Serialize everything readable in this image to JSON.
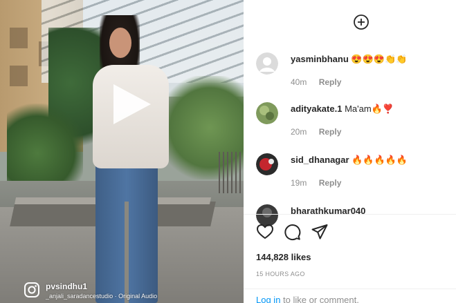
{
  "video": {
    "username": "pvsindhu1",
    "audio": "_anjali_saradancestudio · Original Audio",
    "logo_icon": "instagram-icon",
    "play_icon": "play-icon"
  },
  "panel": {
    "add_icon": "add-circle-icon",
    "comments": [
      {
        "username": "yasminbhanu",
        "text": "",
        "emojis": [
          "😍",
          "😍",
          "😍",
          "👏",
          "👏"
        ],
        "time": "40m",
        "reply_label": "Reply",
        "avatar": "default-avatar"
      },
      {
        "username": "adityakate.1",
        "text": "Ma'am",
        "emojis": [
          "🔥",
          "❣️"
        ],
        "time": "20m",
        "reply_label": "Reply",
        "avatar": "photo-avatar-green"
      },
      {
        "username": "sid_dhanagar",
        "text": "",
        "emojis": [
          "🔥",
          "🔥",
          "🔥",
          "🔥",
          "🔥"
        ],
        "time": "19m",
        "reply_label": "Reply",
        "avatar": "photo-avatar-red"
      },
      {
        "username": "bharathkumar040",
        "text": "",
        "emojis": [],
        "time": "",
        "reply_label": "",
        "avatar": "photo-avatar-dark"
      }
    ],
    "actions": {
      "like_icon": "heart-icon",
      "comment_icon": "comment-icon",
      "share_icon": "share-icon"
    },
    "likes": "144,828 likes",
    "posted": "15 HOURS AGO",
    "login": {
      "link": "Log in",
      "rest": " to like or comment."
    }
  },
  "colors": {
    "link_blue": "#0095f6",
    "meta_gray": "#8e8e8e",
    "text_dark": "#262626"
  }
}
